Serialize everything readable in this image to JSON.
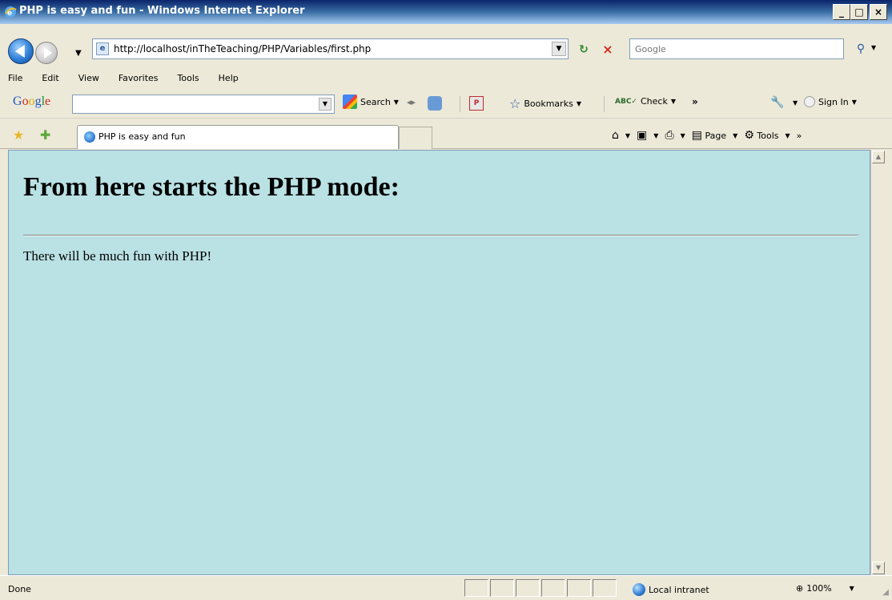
{
  "window": {
    "title": "PHP is easy and fun - Windows Internet Explorer",
    "controls": {
      "minimize": "_",
      "maximize": "□",
      "close": "×"
    }
  },
  "address_bar": {
    "url": "http://localhost/inTheTeaching/PHP/Variables/first.php",
    "search_placeholder": "Google"
  },
  "menu": {
    "items": [
      "File",
      "Edit",
      "View",
      "Favorites",
      "Tools",
      "Help"
    ]
  },
  "google_toolbar": {
    "logo": [
      "G",
      "o",
      "o",
      "g",
      "l",
      "e"
    ],
    "search_label": "Search",
    "bookmarks_label": "Bookmarks",
    "check_label": "Check",
    "more_label": "»",
    "sign_in_label": "Sign In"
  },
  "tabs": {
    "active_title": "PHP is easy and fun"
  },
  "command_bar": {
    "page_label": "Page",
    "tools_label": "Tools",
    "more_label": "»"
  },
  "page": {
    "heading": "From here starts the PHP mode:",
    "paragraph": "There will be much fun with PHP!",
    "background_color": "#bae1e4"
  },
  "status_bar": {
    "status": "Done",
    "zone": "Local intranet",
    "zoom": "100%"
  },
  "icons": {
    "back": "back-arrow-icon",
    "forward": "forward-arrow-icon",
    "refresh": "refresh-icon",
    "stop": "stop-icon",
    "search": "search-icon",
    "favorites": "favorites-star-icon",
    "add_favorite": "add-favorite-icon",
    "home": "home-icon",
    "feeds": "feeds-icon",
    "print": "print-icon",
    "globe": "intranet-globe-icon"
  }
}
